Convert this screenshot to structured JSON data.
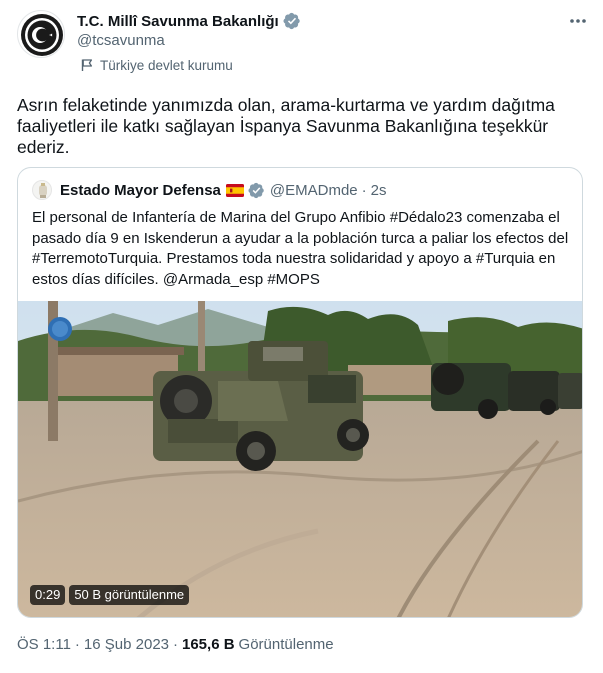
{
  "author": {
    "display_name": "T.C. Millî Savunma Bakanlığı",
    "handle": "@tcsavunma",
    "label": "Türkiye devlet kurumu",
    "more_icon": "ellipsis-icon",
    "verified_color": "#829aab"
  },
  "tweet": {
    "text": "Asrın felaketinde yanımızda olan, arama-kurtarma ve yardım dağıtma faaliyetleri ile katkı sağlayan İspanya Savunma Bakanlığına teşekkür ederiz."
  },
  "quote": {
    "display_name": "Estado Mayor Defensa",
    "handle": "@EMADmde",
    "separator": "·",
    "time": "2s",
    "text": "El personal de Infantería de Marina del Grupo Anfibio #Dédalo23 comenzaba el pasado día 9 en Iskenderun a ayudar a la población turca a paliar los efectos del #TerremotoTurquia. Prestamos toda nuestra solidaridad y apoyo a #Turquia en estos días difíciles. @Armada_esp #MOPS",
    "video": {
      "duration": "0:29",
      "views": "50 B görüntülenme"
    }
  },
  "footer": {
    "time": "ÖS 1:11",
    "sep1": "·",
    "date": "16 Şub 2023",
    "sep2": "·",
    "views_count": "165,6 B",
    "views_label": "Görüntülenme"
  },
  "colors": {
    "text_primary": "#0f1419",
    "text_secondary": "#536471",
    "border": "#cfd9de"
  }
}
